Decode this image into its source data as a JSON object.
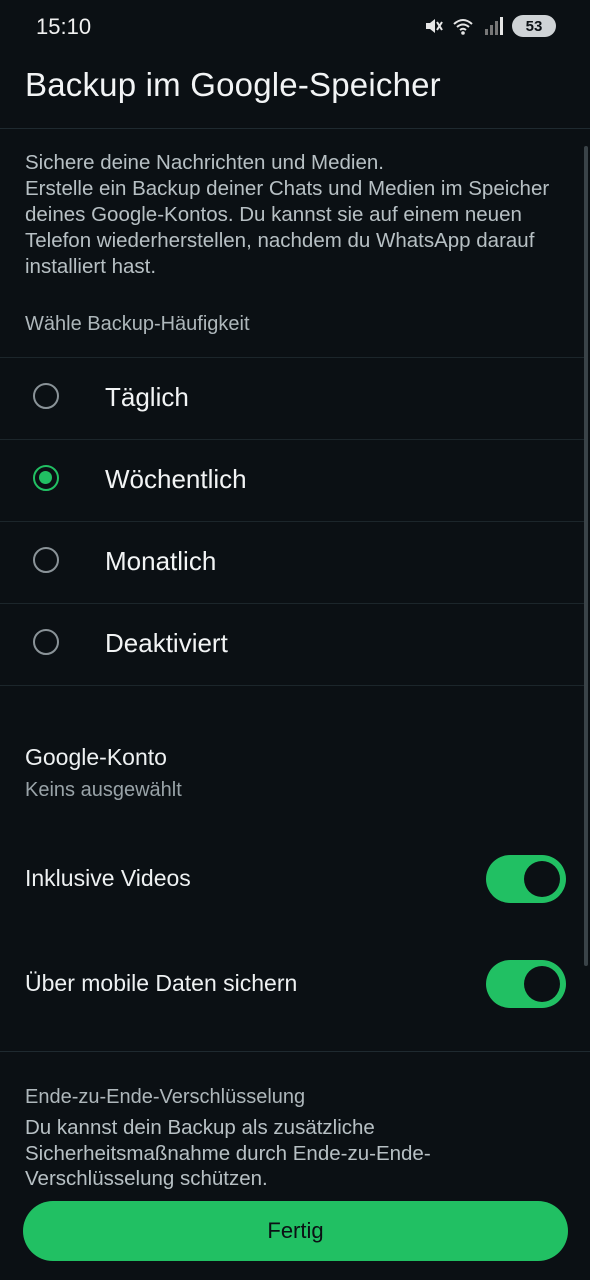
{
  "status_bar": {
    "time": "15:10",
    "battery": "53",
    "icons": [
      "mute-icon",
      "wifi-icon",
      "signal-icon"
    ]
  },
  "header": {
    "title": "Backup im Google-Speicher"
  },
  "description": {
    "line1": "Sichere deine Nachrichten und Medien.",
    "line2": "Erstelle ein Backup deiner Chats und Medien im Speicher deines Google-Kontos. Du kannst sie auf einem neuen Telefon wiederherstellen, nachdem du WhatsApp darauf installiert hast."
  },
  "frequency": {
    "label": "Wähle Backup-Häufigkeit",
    "options": [
      {
        "label": "Täglich",
        "selected": false
      },
      {
        "label": "Wöchentlich",
        "selected": true
      },
      {
        "label": "Monatlich",
        "selected": false
      },
      {
        "label": "Deaktiviert",
        "selected": false
      }
    ]
  },
  "google_account": {
    "title": "Google-Konto",
    "value": "Keins ausgewählt"
  },
  "toggles": {
    "include_videos": {
      "label": "Inklusive Videos",
      "on": true
    },
    "mobile_data": {
      "label": "Über mobile Daten sichern",
      "on": true
    }
  },
  "encryption": {
    "title": "Ende-zu-Ende-Verschlüsselung",
    "description": "Du kannst dein Backup als zusätzliche Sicherheitsmaßnahme durch Ende-zu-Ende-Verschlüsselung schützen."
  },
  "done_button": {
    "label": "Fertig"
  },
  "colors": {
    "background": "#0b1014",
    "accent": "#21c063"
  }
}
